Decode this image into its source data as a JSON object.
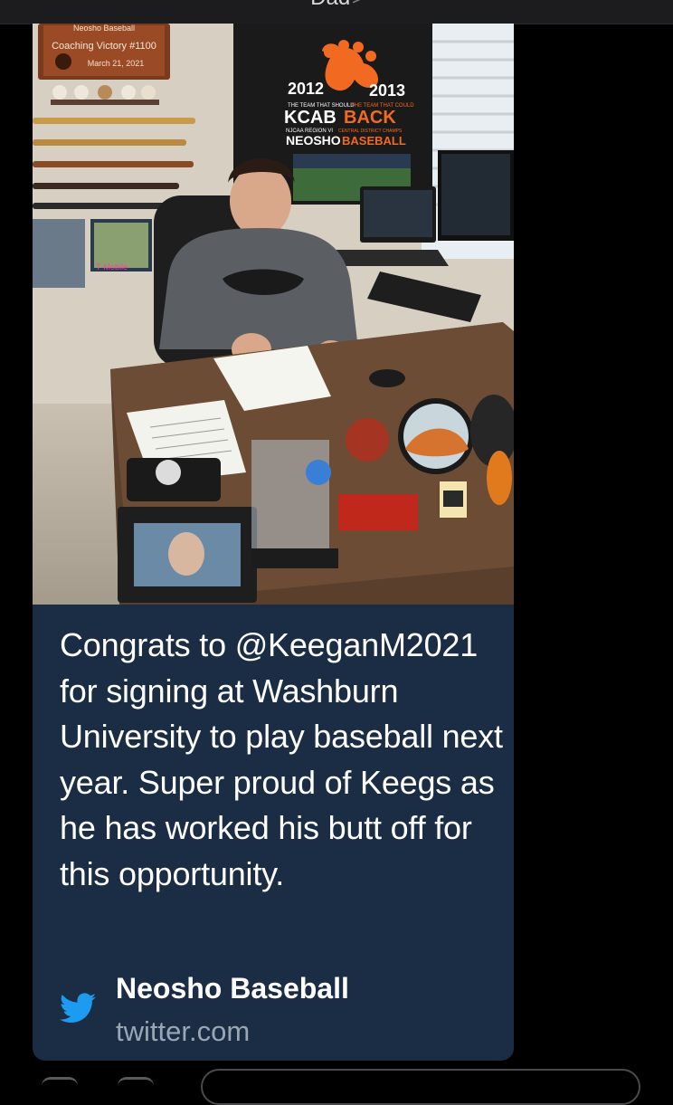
{
  "header": {
    "contact_name": "Dad",
    "chevron": ">"
  },
  "photo": {
    "alt": "",
    "plaque_title": "Neosho Baseball",
    "plaque_line1": "Coaching Victory #1100",
    "plaque_date": "March 21, 2021",
    "poster_year_left": "2012",
    "poster_year_right": "2013",
    "poster_small1": "THE TEAM THAT SHOULD",
    "poster_small2": "THE TEAM THAT COULD",
    "poster_back_mirror": "KCAB",
    "poster_back": "BACK",
    "poster_region": "NJCAA REGION VI",
    "poster_champs": "CENTRAL DISTRICT CHAMPS",
    "poster_neosho": "NEOSHO",
    "poster_baseball": "BASEBALL",
    "mobile_sign": "T·Mobile"
  },
  "tweet": {
    "text": "Congrats to @KeeganM2021 for signing at Washburn University to play baseball next year. Super proud of Keegs as he has worked his butt off for this opportunity.",
    "source_name": "Neosho Baseball",
    "source_domain": "twitter.com",
    "source_icon": "twitter-bird-icon",
    "colors": {
      "card_bg": "#1b2d45",
      "twitter_blue": "#1d9bf0",
      "domain_gray": "#9aa6b4",
      "paw_orange": "#f26a21"
    }
  }
}
